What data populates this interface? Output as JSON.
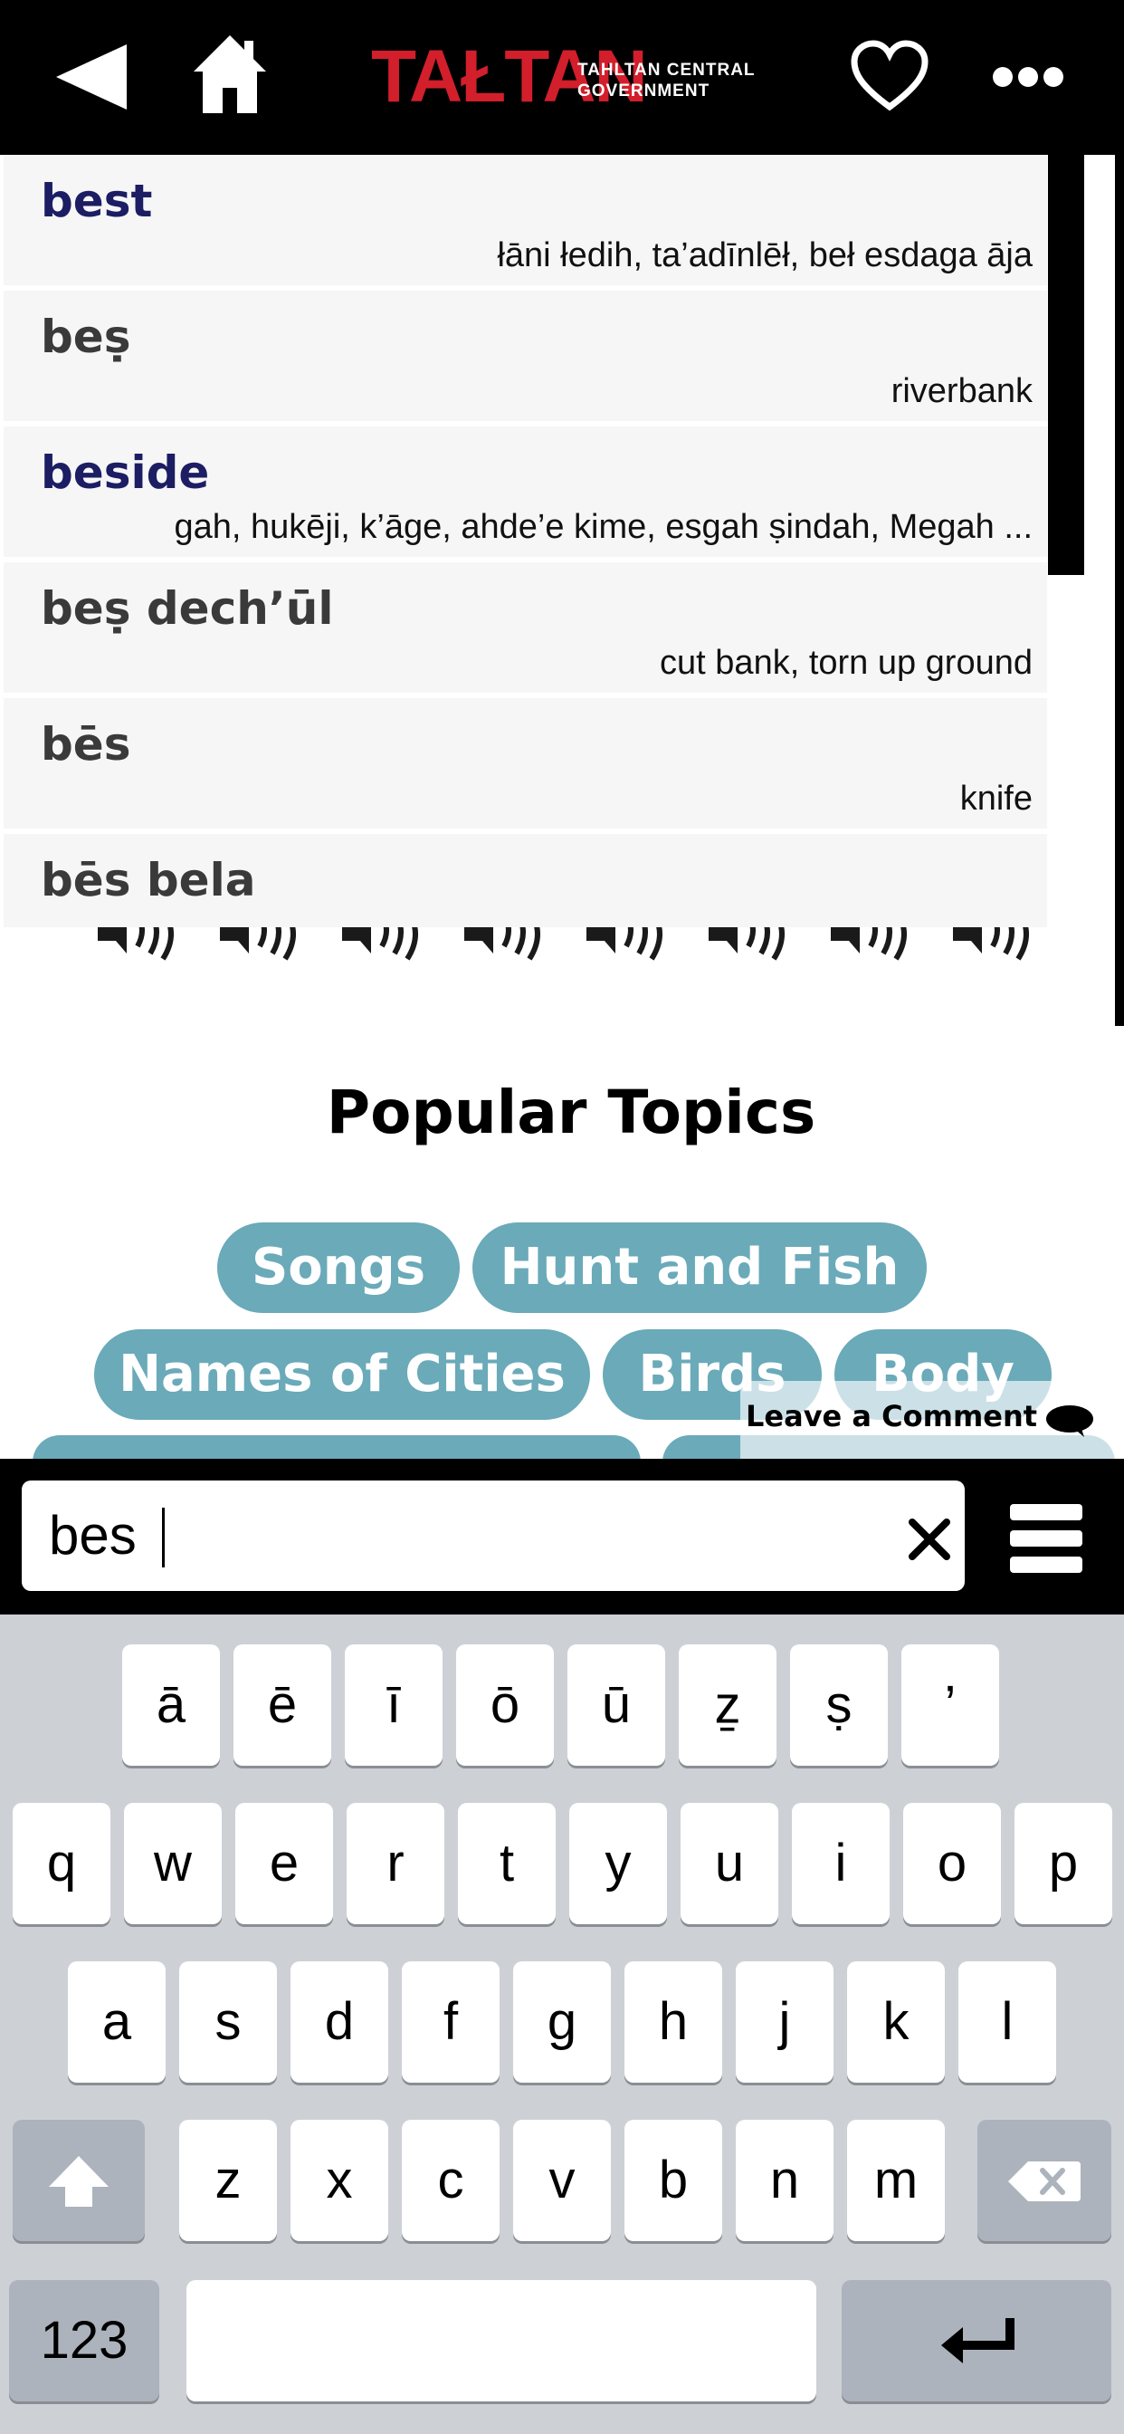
{
  "header": {
    "logo_main": "TAŁTAN",
    "logo_sub_line1": "TAHLTAN CENTRAL",
    "logo_sub_line2": "GOVERNMENT",
    "icons": [
      "back-arrow-icon",
      "home-icon",
      "heart-icon",
      "more-dots-icon"
    ]
  },
  "suggestions": [
    {
      "term": "best",
      "translation": "łāni łedih, ta’adīnlēł, beł esdaga āja",
      "is_english": true
    },
    {
      "term": "beṣ",
      "translation": "riverbank",
      "is_english": false
    },
    {
      "term": "beside",
      "translation": "gah, hukēji, k’āge, ahde’e kime, esgah ṣindah, Megah ...",
      "is_english": true
    },
    {
      "term": "beṣ dech’ūl",
      "translation": "cut bank, torn up ground",
      "is_english": false
    },
    {
      "term": "bēs",
      "translation": "knife",
      "is_english": false
    },
    {
      "term": "bēs bela",
      "translation": "",
      "is_english": false
    }
  ],
  "popular": {
    "title": "Popular Topics",
    "chips": [
      "Songs",
      "Hunt and Fish",
      "Names of Cities",
      "Birds",
      "Body"
    ]
  },
  "comment": {
    "label": "Leave a Comment",
    "icon": "speech-bubble-icon"
  },
  "search": {
    "value": "bes",
    "placeholder": ""
  },
  "keyboard": {
    "special_row": [
      "ā",
      "ē",
      "ī",
      "ō",
      "ū",
      "ẕ",
      "ṣ",
      "’"
    ],
    "row1": [
      "q",
      "w",
      "e",
      "r",
      "t",
      "y",
      "u",
      "i",
      "o",
      "p"
    ],
    "row2": [
      "a",
      "s",
      "d",
      "f",
      "g",
      "h",
      "j",
      "k",
      "l"
    ],
    "row3": [
      "z",
      "x",
      "c",
      "v",
      "b",
      "n",
      "m"
    ],
    "numbers_label": "123"
  },
  "colors": {
    "chip": "#6aaab9",
    "logo_red": "#d21f2b",
    "english_term": "#1c1d63"
  }
}
